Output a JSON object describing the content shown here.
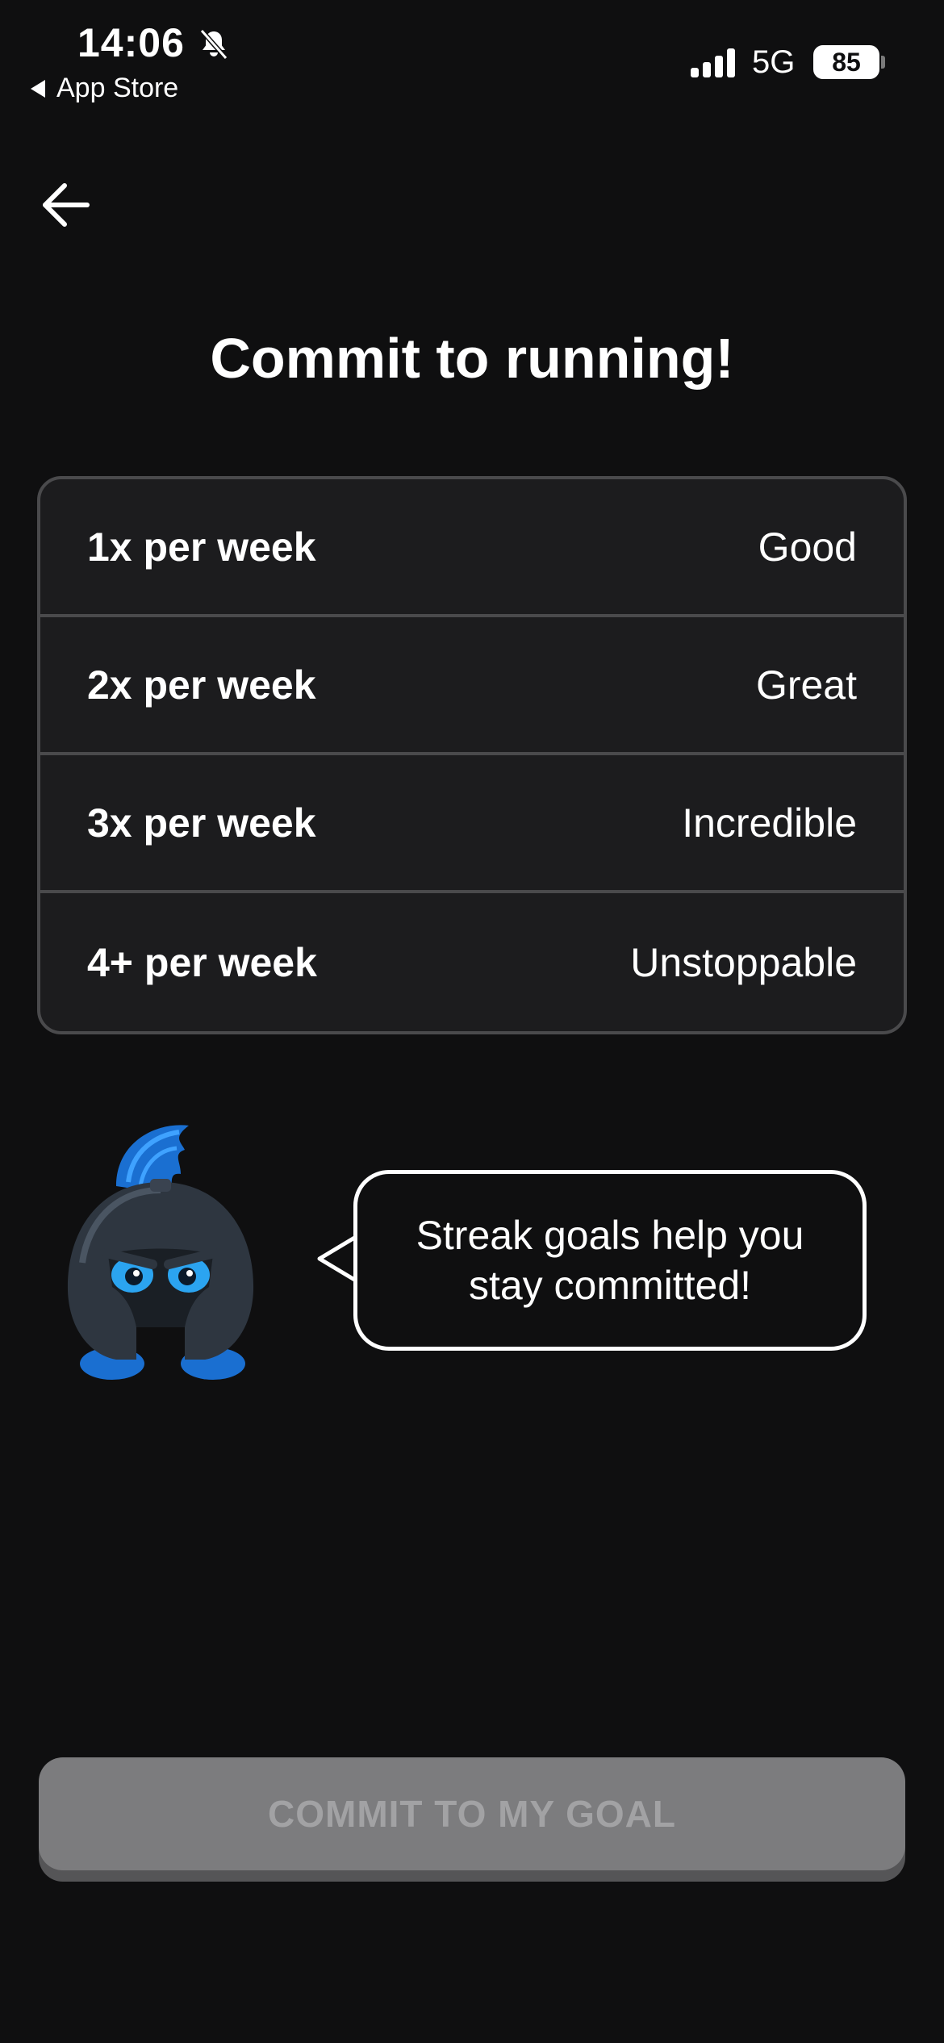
{
  "status_bar": {
    "time": "14:06",
    "back_app_label": "App Store",
    "network": "5G",
    "battery": "85"
  },
  "page": {
    "title": "Commit to running!"
  },
  "options": [
    {
      "frequency": "1x per week",
      "rating": "Good"
    },
    {
      "frequency": "2x per week",
      "rating": "Great"
    },
    {
      "frequency": "3x per week",
      "rating": "Incredible"
    },
    {
      "frequency": "4+ per week",
      "rating": "Unstoppable"
    }
  ],
  "mascot": {
    "message": "Streak goals help you stay committed!"
  },
  "cta": {
    "label": "COMMIT TO MY GOAL"
  }
}
